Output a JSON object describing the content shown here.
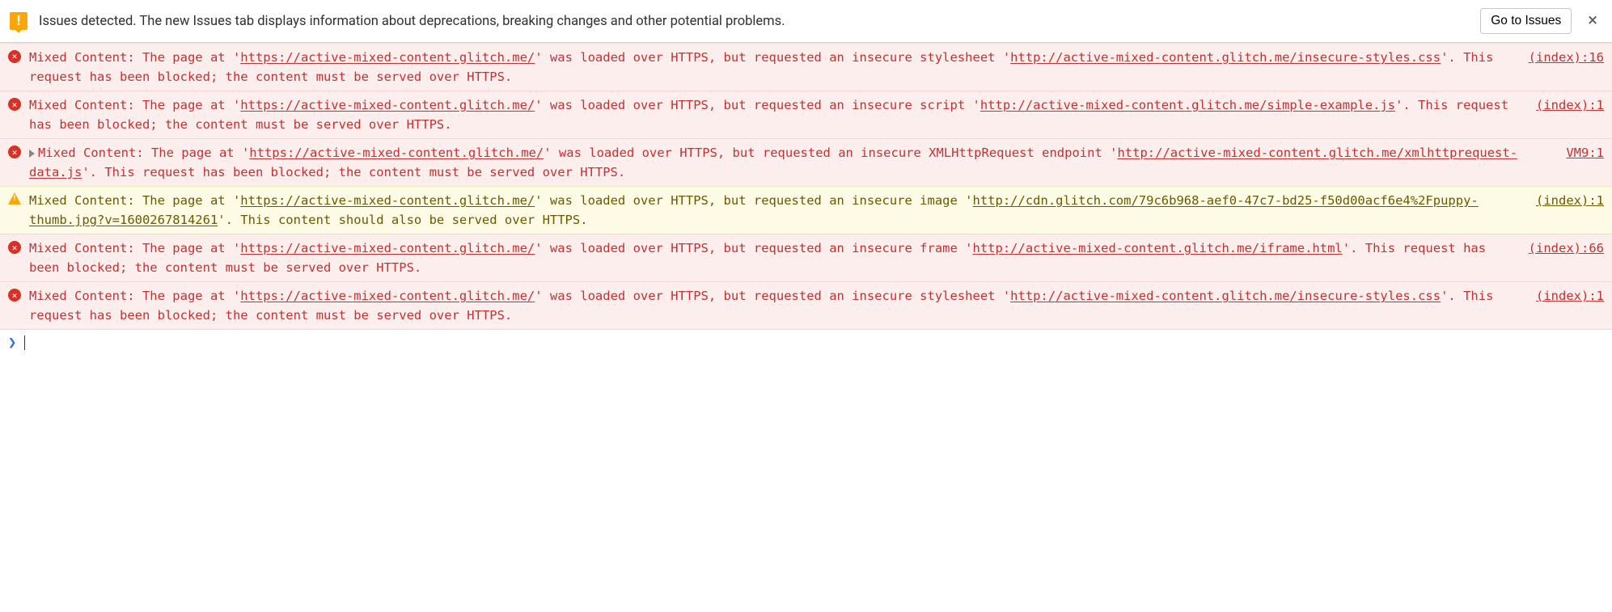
{
  "issues_bar": {
    "text": "Issues detected. The new Issues tab displays information about deprecations, breaking changes and other potential problems.",
    "button": "Go to Issues"
  },
  "messages": [
    {
      "level": "error",
      "expandable": false,
      "source": "(index):16",
      "parts": [
        {
          "t": "plain",
          "v": "Mixed Content: The page at '"
        },
        {
          "t": "link",
          "v": "https://active-mixed-content.glitch.me/"
        },
        {
          "t": "plain",
          "v": "' was loaded over HTTPS, but requested an insecure stylesheet '"
        },
        {
          "t": "link",
          "v": "http://active-mixed-content.glitch.me/insecure-styles.css"
        },
        {
          "t": "plain",
          "v": "'. This request has been blocked; the content must be served over HTTPS."
        }
      ]
    },
    {
      "level": "error",
      "expandable": false,
      "source": "(index):1",
      "parts": [
        {
          "t": "plain",
          "v": "Mixed Content: The page at '"
        },
        {
          "t": "link",
          "v": "https://active-mixed-content.glitch.me/"
        },
        {
          "t": "plain",
          "v": "' was loaded over HTTPS, but requested an insecure script '"
        },
        {
          "t": "link",
          "v": "http://active-mixed-content.glitch.me/simple-example.js"
        },
        {
          "t": "plain",
          "v": "'. This request has been blocked; the content must be served over HTTPS."
        }
      ]
    },
    {
      "level": "error",
      "expandable": true,
      "source": "VM9:1",
      "parts": [
        {
          "t": "plain",
          "v": "Mixed Content: The page at '"
        },
        {
          "t": "link",
          "v": "https://active-mixed-content.glitch.me/"
        },
        {
          "t": "plain",
          "v": "' was loaded over HTTPS, but requested an insecure XMLHttpRequest endpoint '"
        },
        {
          "t": "link",
          "v": "http://active-mixed-content.glitch.me/xmlhttprequest-data.js"
        },
        {
          "t": "plain",
          "v": "'. This request has been blocked; the content must be served over HTTPS."
        }
      ]
    },
    {
      "level": "warning",
      "expandable": false,
      "source": "(index):1",
      "parts": [
        {
          "t": "plain",
          "v": "Mixed Content: The page at '"
        },
        {
          "t": "link",
          "v": "https://active-mixed-content.glitch.me/"
        },
        {
          "t": "plain",
          "v": "' was loaded over HTTPS, but requested an insecure image '"
        },
        {
          "t": "link",
          "v": "http://cdn.glitch.com/79c6b968-aef0-47c7-bd25-f50d00acf6e4%2Fpuppy-thumb.jpg?v=1600267814261"
        },
        {
          "t": "plain",
          "v": "'. This content should also be served over HTTPS."
        }
      ]
    },
    {
      "level": "error",
      "expandable": false,
      "source": "(index):66",
      "parts": [
        {
          "t": "plain",
          "v": "Mixed Content: The page at '"
        },
        {
          "t": "link",
          "v": "https://active-mixed-content.glitch.me/"
        },
        {
          "t": "plain",
          "v": "' was loaded over HTTPS, but requested an insecure frame '"
        },
        {
          "t": "link",
          "v": "http://active-mixed-content.glitch.me/iframe.html"
        },
        {
          "t": "plain",
          "v": "'. This request has been blocked; the content must be served over HTTPS."
        }
      ]
    },
    {
      "level": "error",
      "expandable": false,
      "source": "(index):1",
      "parts": [
        {
          "t": "plain",
          "v": "Mixed Content: The page at '"
        },
        {
          "t": "link",
          "v": "https://active-mixed-content.glitch.me/"
        },
        {
          "t": "plain",
          "v": "' was loaded over HTTPS, but requested an insecure stylesheet '"
        },
        {
          "t": "link",
          "v": "http://active-mixed-content.glitch.me/insecure-styles.css"
        },
        {
          "t": "plain",
          "v": "'. This request has been blocked; the content must be served over HTTPS."
        }
      ]
    }
  ]
}
